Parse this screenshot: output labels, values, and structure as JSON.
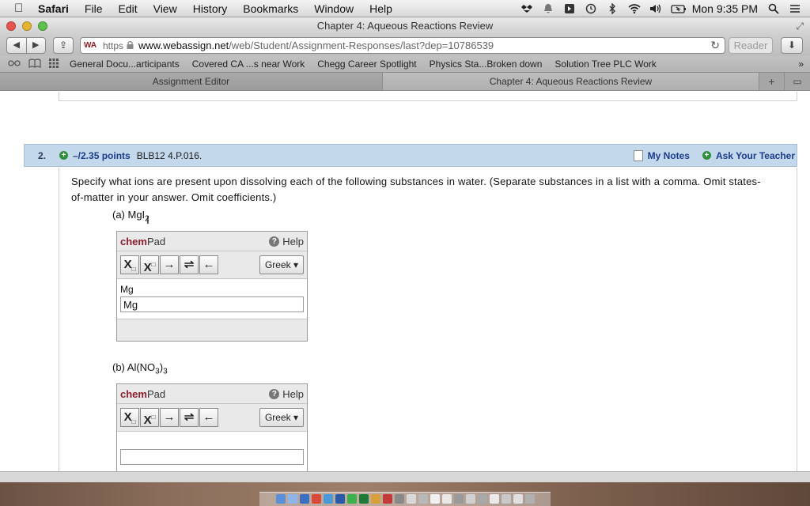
{
  "menubar": {
    "apple": "",
    "items": [
      "Safari",
      "File",
      "Edit",
      "View",
      "History",
      "Bookmarks",
      "Window",
      "Help"
    ],
    "clock": "Mon 9:35 PM"
  },
  "window": {
    "title": "Chapter 4: Aqueous Reactions Review"
  },
  "toolbar": {
    "back": "◀",
    "forward": "▶",
    "share": "⇪",
    "favicon": "WA",
    "scheme": "https",
    "host": "www.webassign.net",
    "path": "/web/Student/Assignment-Responses/last?dep=10786539",
    "reload": "↻",
    "reader": "Reader",
    "download": "⬇"
  },
  "bookmarks": {
    "items": [
      "General Docu...articipants",
      "Covered CA ...s near Work",
      "Chegg Career Spotlight",
      "Physics Sta...Broken down",
      "Solution Tree PLC Work"
    ],
    "more": "»"
  },
  "tabs": [
    {
      "label": "Assignment Editor",
      "active": false
    },
    {
      "label": "Chapter 4: Aqueous Reactions Review",
      "active": true
    }
  ],
  "question": {
    "number": "2.",
    "points": "–/2.35 points",
    "code": "BLB12 4.P.016.",
    "my_notes": "My Notes",
    "ask_teacher": "Ask Your Teacher",
    "prompt": "Specify what ions are present upon dissolving each of the following substances in water. (Separate substances in a list with a comma. Omit states-of-matter in your answer. Omit coefficients.)",
    "parts": [
      {
        "label_prefix": "(a) MgI",
        "label_sub": "2",
        "label_after": "",
        "preview": "Mg",
        "input_value": "Mg"
      },
      {
        "label_prefix": "(b) Al(NO",
        "label_sub": "3",
        "label_after": ")",
        "label_sub2": "3",
        "preview": "",
        "input_value": ""
      }
    ]
  },
  "chempad": {
    "title_bold": "chem",
    "title_rest": "Pad",
    "help": "Help",
    "help_icon": "?",
    "greek": "Greek ▾",
    "tools": {
      "subscript": "X",
      "subscript_mark": "□",
      "superscript": "X",
      "superscript_mark": "□",
      "arrow": "→",
      "equilibrium": "⇌",
      "backspace": "←"
    }
  },
  "colors": {
    "question_header_bg": "#c4d8ec",
    "link_blue": "#1b3b8b",
    "chem_red": "#8b1d2c",
    "plus_green": "#2f8f3a"
  }
}
